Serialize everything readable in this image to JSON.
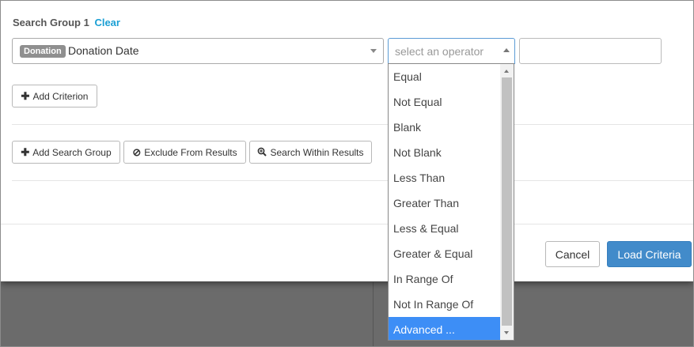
{
  "group": {
    "title": "Search Group 1",
    "clear_label": "Clear"
  },
  "field": {
    "badge": "Donation",
    "value": "Donation Date"
  },
  "operator": {
    "placeholder": "select an operator",
    "options": [
      "Equal",
      "Not Equal",
      "Blank",
      "Not Blank",
      "Less Than",
      "Greater Than",
      "Less & Equal",
      "Greater & Equal",
      "In Range Of",
      "Not In Range Of",
      "Advanced ..."
    ],
    "highlighted": "Advanced ..."
  },
  "buttons": {
    "add_criterion": "Add Criterion",
    "add_search_group": "Add Search Group",
    "exclude_from_results": "Exclude From Results",
    "search_within_results": "Search Within Results",
    "cancel": "Cancel",
    "load_criteria": "Load Criteria"
  },
  "colors": {
    "primary": "#428bca",
    "link": "#1a9fd4",
    "highlight": "#3d8ef6",
    "badge": "#8f8f8f",
    "backdrop": "#6b6b6b"
  }
}
